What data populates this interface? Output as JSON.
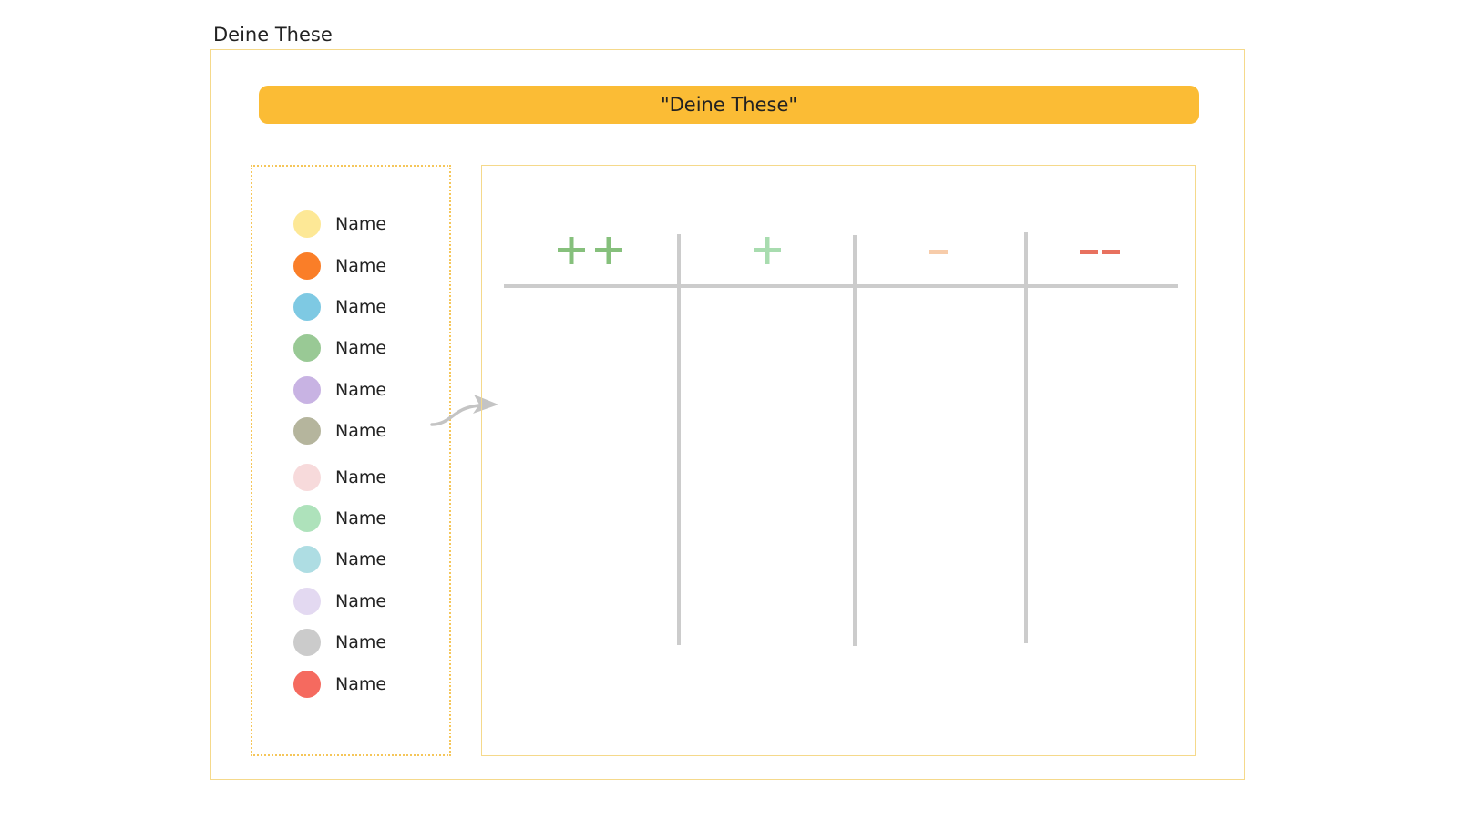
{
  "page_label": "Deine These",
  "thesis_banner": "\"Deine These\"",
  "legend": {
    "items": [
      {
        "label": "Name",
        "color": "#fde896"
      },
      {
        "label": "Name",
        "color": "#fa7e28"
      },
      {
        "label": "Name",
        "color": "#7ec9e3"
      },
      {
        "label": "Name",
        "color": "#99c995"
      },
      {
        "label": "Name",
        "color": "#c8b3e3"
      },
      {
        "label": "Name",
        "color": "#b5b59d"
      },
      {
        "label": "Name",
        "color": "#f7dadb"
      },
      {
        "label": "Name",
        "color": "#aee2bb"
      },
      {
        "label": "Name",
        "color": "#aeddE3"
      },
      {
        "label": "Name",
        "color": "#e3d9f1"
      },
      {
        "label": "Name",
        "color": "#cbcbcb"
      },
      {
        "label": "Name",
        "color": "#f56a5f"
      }
    ]
  },
  "rating_columns": [
    {
      "symbol": "++",
      "icon": "double-plus-icon",
      "color": "#86c07c"
    },
    {
      "symbol": "+",
      "icon": "plus-icon",
      "color": "#a8dcaf"
    },
    {
      "symbol": "-",
      "icon": "minus-icon",
      "color": "#f7ccaa"
    },
    {
      "symbol": "--",
      "icon": "double-minus-icon",
      "color": "#e8715f"
    }
  ],
  "colors": {
    "banner": "#fbbc35",
    "frame_border": "#f5d98b",
    "legend_border": "#f5c65a",
    "grid_lines": "#cccccc",
    "arrow": "#c4c4c4"
  }
}
